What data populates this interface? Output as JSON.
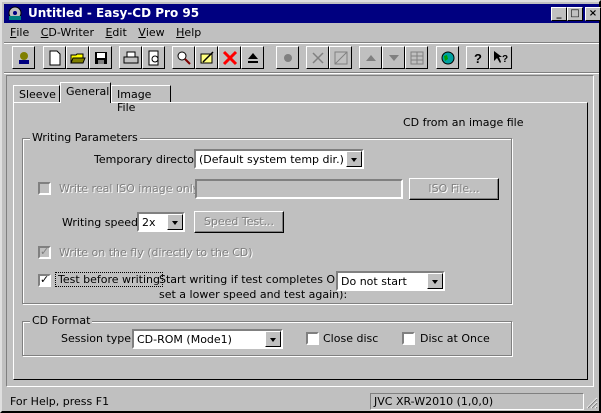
{
  "window": {
    "title": "Untitled - Easy-CD Pro 95"
  },
  "titlebar_buttons": {
    "minimize": "_",
    "maximize": "□",
    "close": "×"
  },
  "menu": [
    {
      "label": "File",
      "accel": "F",
      "rest": "ile"
    },
    {
      "label": "CD-Writer",
      "accel": "C",
      "rest": "D-Writer"
    },
    {
      "label": "Edit",
      "accel": "E",
      "rest": "dit"
    },
    {
      "label": "View",
      "accel": "V",
      "rest": "iew"
    },
    {
      "label": "Help",
      "accel": "H",
      "rest": "elp"
    }
  ],
  "toolbar_icons": [
    "wizard-icon",
    "new-file-icon",
    "open-folder-icon",
    "save-disk-icon",
    "print-icon",
    "print-preview-icon",
    "find-icon",
    "properties-icon",
    "delete-icon",
    "eject-icon",
    "record-icon",
    "cut-icon",
    "copy-icon",
    "move-up-icon",
    "move-down-icon",
    "grid-icon",
    "globe-icon",
    "help-icon",
    "context-help-icon"
  ],
  "tabs": [
    "Sleeve",
    "General",
    "Image File"
  ],
  "active_tab": "General",
  "mode_text": "CD from an image file",
  "writing": {
    "group_label": "Writing Parameters",
    "temp_dir_label": "Temporary directory:",
    "temp_dir_value": "(Default system temp dir.)",
    "real_iso_label": "Write real ISO image only to",
    "real_iso_checked": false,
    "iso_button": "ISO File...",
    "speed_label": "Writing speed:",
    "speed_value": "2x",
    "speed_test_button": "Speed Test...",
    "on_the_fly_label": "Write on the fly (directly to the CD)",
    "on_the_fly_checked": true,
    "test_label": "Test before writing",
    "test_checked": true,
    "start_text_line1": "Start writing if test completes OK (or",
    "start_text_line2": "set a lower speed and test again):",
    "start_value": "Do not start"
  },
  "format": {
    "group_label": "CD Format",
    "session_label": "Session type:",
    "session_value": "CD-ROM (Mode1)",
    "close_disc_label": "Close disc",
    "close_disc_checked": false,
    "dao_label": "Disc at Once",
    "dao_checked": false
  },
  "status": {
    "help": "For Help, press F1",
    "drive": "JVC XR-W2010 (1,0,0)"
  },
  "colors": {
    "face": "#c0c0c0",
    "titlebar": "#000080",
    "disabled": "#808080"
  }
}
